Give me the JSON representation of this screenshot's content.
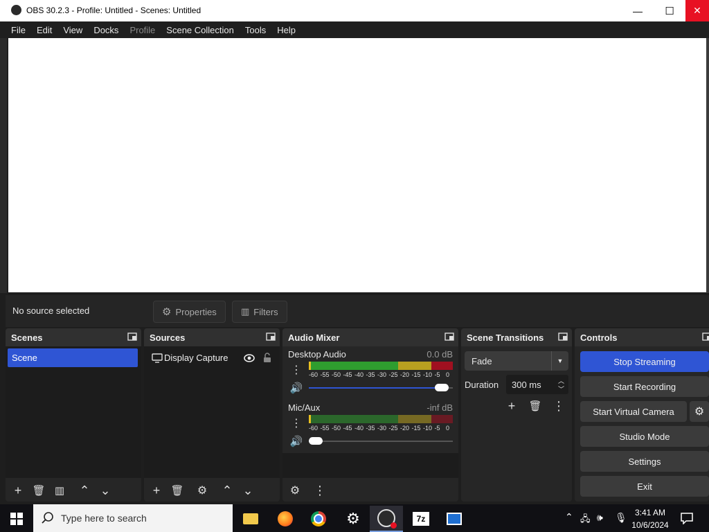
{
  "window": {
    "title": "OBS 30.2.3 - Profile: Untitled - Scenes: Untitled",
    "minimize_glyph": "—",
    "maximize_glyph": "☐",
    "close_glyph": "✕"
  },
  "menu": [
    "File",
    "Edit",
    "View",
    "Docks",
    "Profile",
    "Scene Collection",
    "Tools",
    "Help"
  ],
  "source_toolbar": {
    "status": "No source selected",
    "properties_label": "Properties",
    "filters_label": "Filters"
  },
  "scenes": {
    "title": "Scenes",
    "items": [
      "Scene"
    ]
  },
  "sources": {
    "title": "Sources",
    "items": [
      "Display Capture"
    ]
  },
  "audio_mixer": {
    "title": "Audio Mixer",
    "channels": [
      {
        "name": "Desktop Audio",
        "level": "0.0 dB",
        "volume": 0.97
      },
      {
        "name": "Mic/Aux",
        "level": "-inf dB",
        "volume": 0.05
      }
    ],
    "scale": [
      "-60",
      "-55",
      "-50",
      "-45",
      "-40",
      "-35",
      "-30",
      "-25",
      "-20",
      "-15",
      "-10",
      "-5",
      "0"
    ]
  },
  "scene_transitions": {
    "title": "Scene Transitions",
    "transition": "Fade",
    "duration_label": "Duration",
    "duration_value": "300 ms"
  },
  "controls": {
    "title": "Controls",
    "stop_streaming": "Stop Streaming",
    "start_recording": "Start Recording",
    "start_virtual_camera": "Start Virtual Camera",
    "studio_mode": "Studio Mode",
    "settings": "Settings",
    "exit": "Exit"
  },
  "taskbar": {
    "search_placeholder": "Type here to search",
    "time": "3:41 AM",
    "date": "10/6/2024"
  },
  "colors": {
    "accent": "#2f55d4",
    "close_red": "#e81123",
    "meter_green": "#2f9d2f",
    "meter_yellow": "#b8a020",
    "meter_red": "#a01020"
  }
}
